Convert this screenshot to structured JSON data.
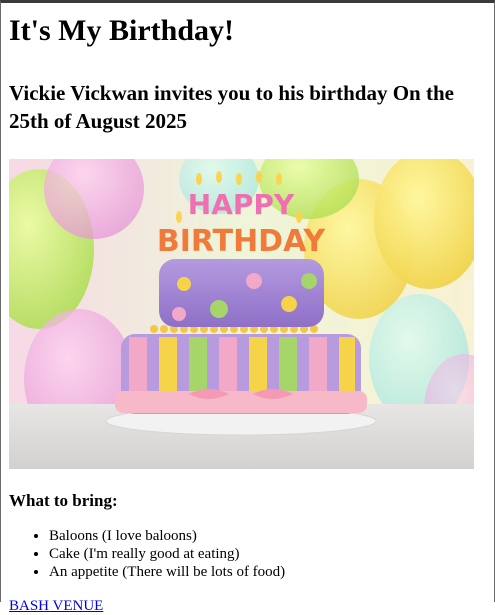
{
  "page": {
    "title": "It's My Birthday!",
    "invite": "Vickie Vickwan invites you to his birthday On the 25th of August 2025",
    "image_alt": "Birthday cake with Happy Birthday candles",
    "cake_candles_text": {
      "line1": "HAPPY",
      "line2": "BIRTHDAY"
    },
    "bring_heading": "What to bring:",
    "bring_items": [
      "Baloons (I love baloons)",
      "Cake (I'm really good at eating)",
      "An appetite (There will be lots of food)"
    ],
    "venue_link": "BASH VENUE"
  },
  "colors": {
    "link": "#0000ee",
    "cake_top": "#9b7fd0",
    "cake_bottom_pink": "#f2a8c7",
    "cake_bottom_yellow": "#f5d44a",
    "cake_bottom_green": "#a6d66a",
    "ribbon": "#f7b9c8"
  }
}
